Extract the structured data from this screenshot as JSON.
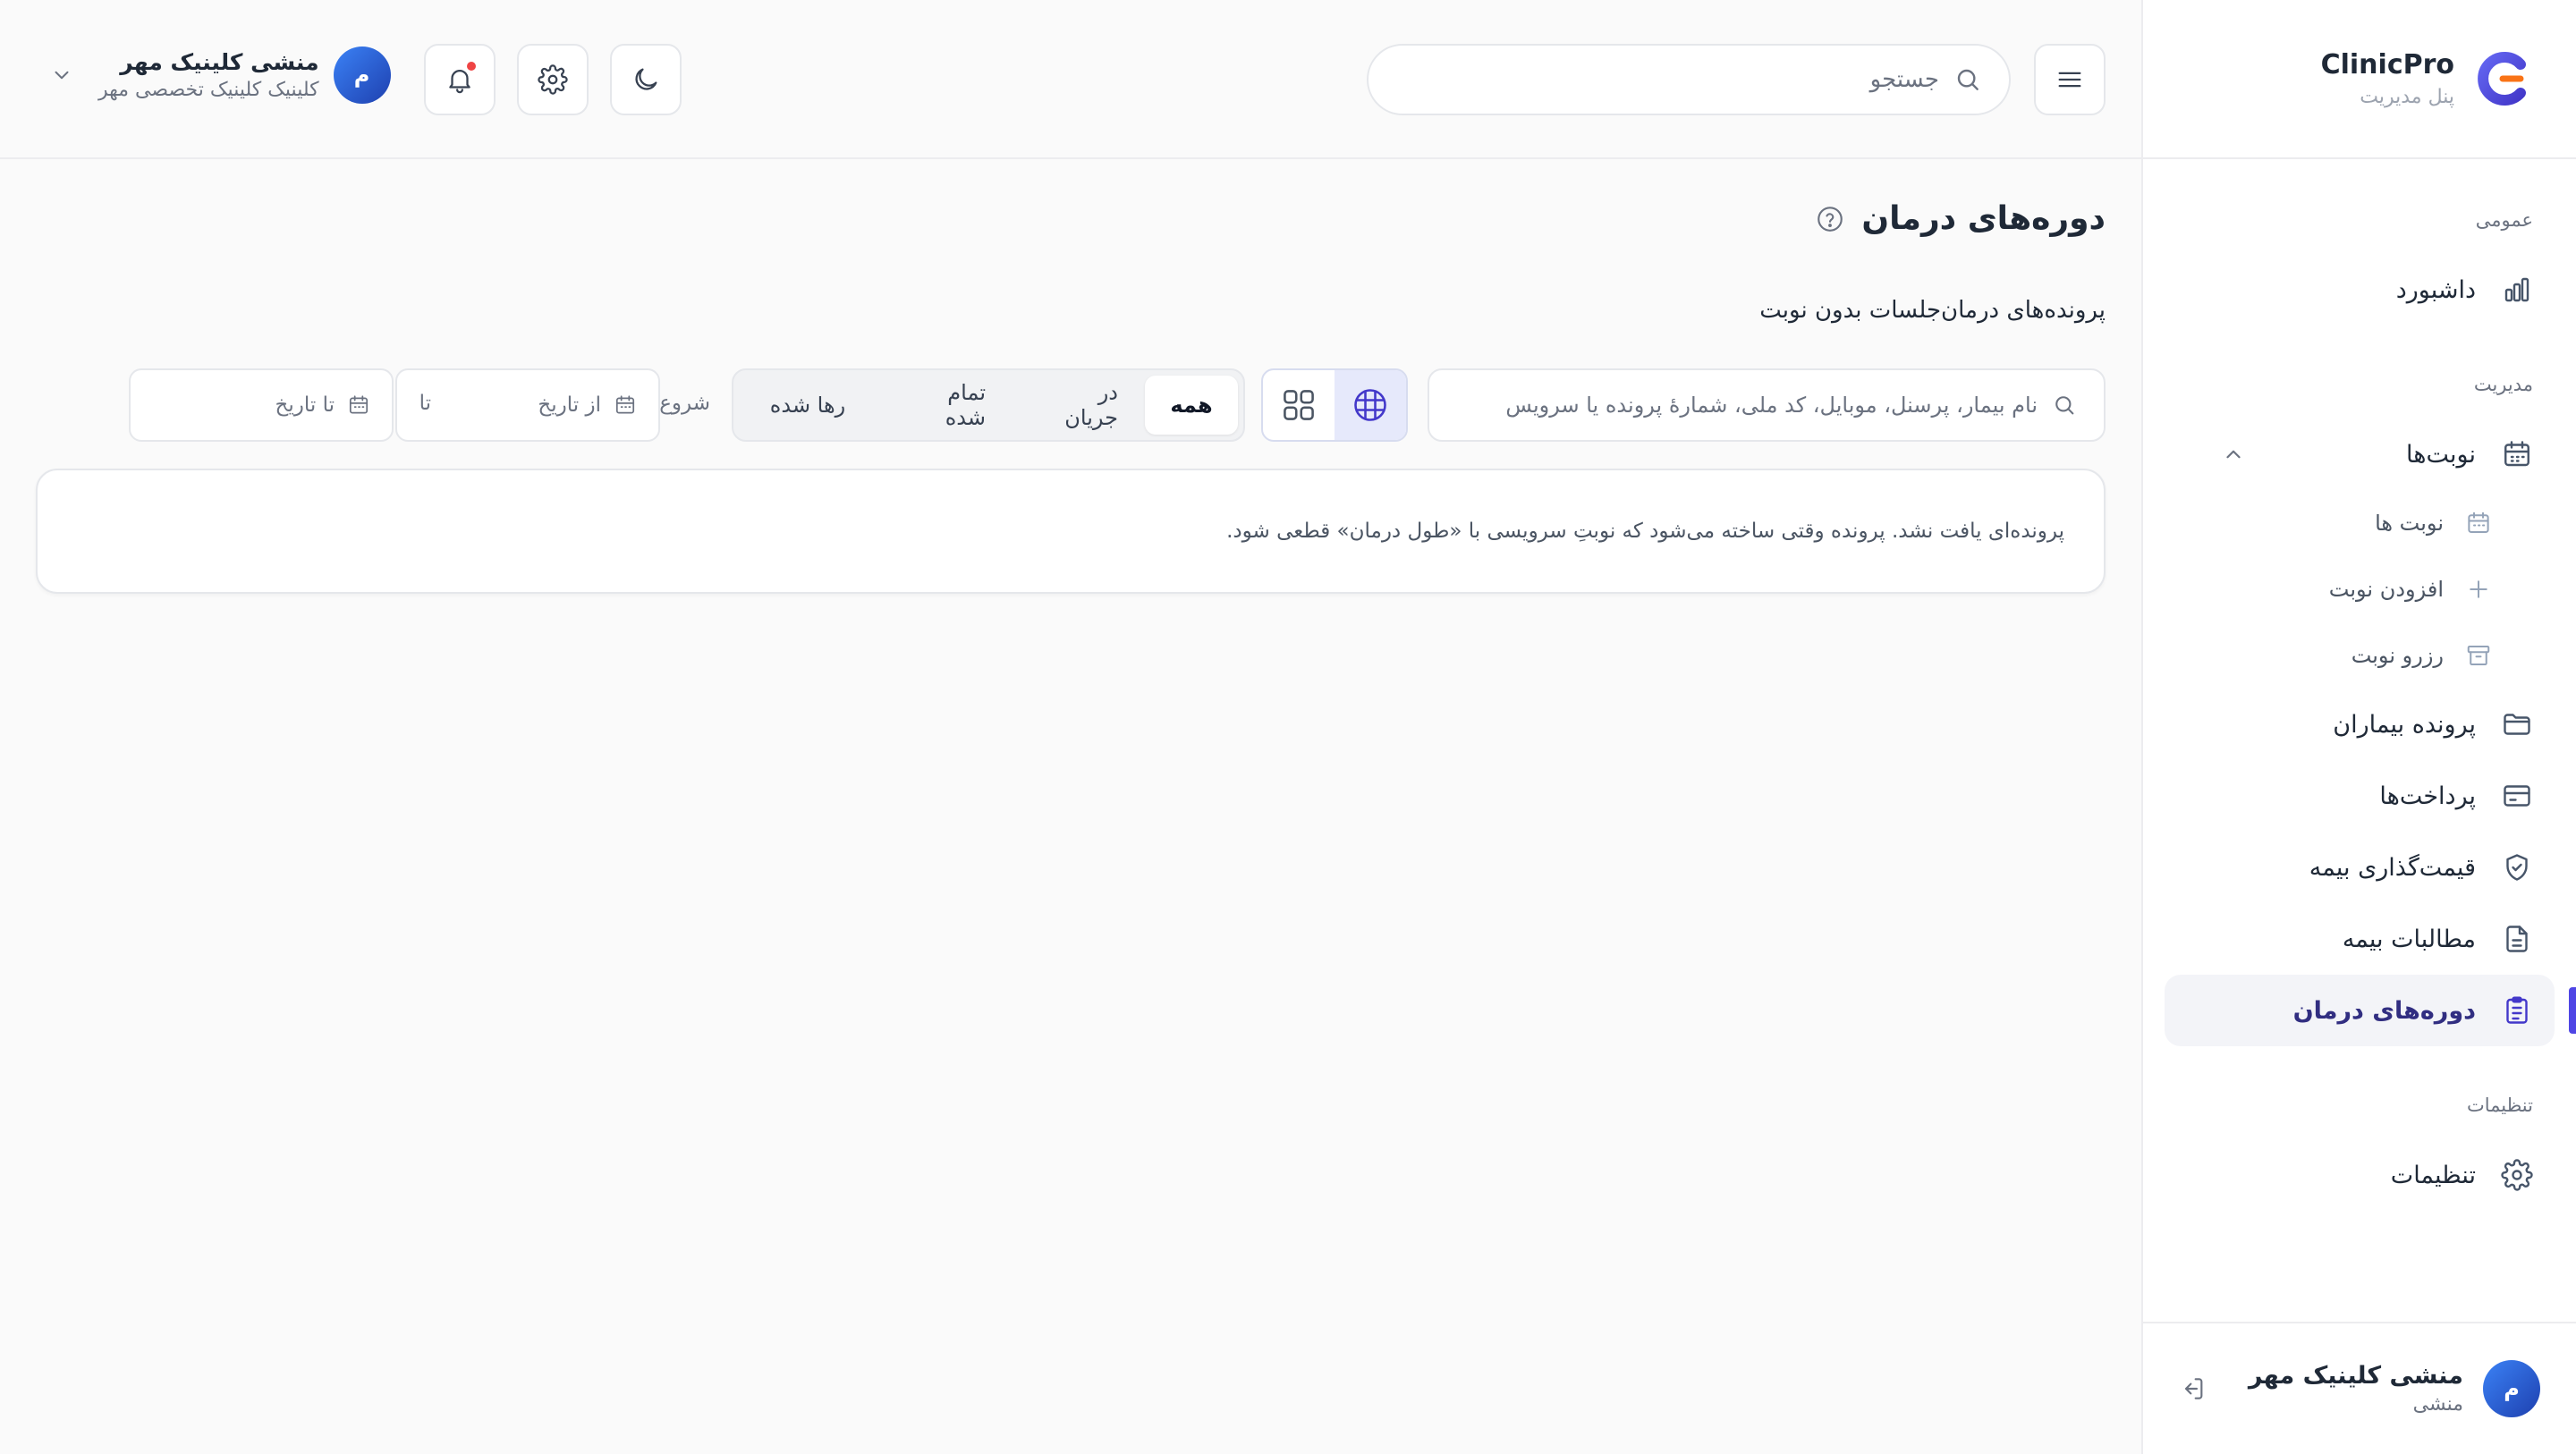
{
  "brand": {
    "name": "ClinicPro",
    "subtitle": "پنل مدیریت"
  },
  "sidebar": {
    "sections": {
      "general": "عمومی",
      "management": "مدیریت",
      "settings": "تنظیمات"
    },
    "items": {
      "dashboard": "داشبورد",
      "appointments": "نوبت‌ها",
      "appointments_list": "نوبت ها",
      "add_appointment": "افزودن نوبت",
      "reserve_appointment": "رزرو نوبت",
      "patient_records": "پرونده بیماران",
      "payments": "پرداخت‌ها",
      "insurance_pricing": "قیمت‌گذاری بیمه",
      "insurance_claims": "مطالبات بیمه",
      "treatment_courses": "دوره‌های درمان",
      "settings": "تنظیمات"
    },
    "footer": {
      "avatar_initial": "م",
      "name": "منشی کلینیک مهر",
      "role": "منشی"
    }
  },
  "header": {
    "search_placeholder": "جستجو",
    "user": {
      "avatar_initial": "م",
      "name": "منشی کلینیک مهر",
      "clinic": "کلینیک کلینیک تخصصی مهر"
    }
  },
  "main": {
    "title": "دوره‌های درمان",
    "subtitle": "پرونده‌های درمان‌جلسات بدون نوبت",
    "search_placeholder": "نام بیمار، پرسنل، موبایل، کد ملی، شمارهٔ پرونده یا سرویس",
    "tabs": [
      "همه",
      "در جریان",
      "تمام شده",
      "رها شده"
    ],
    "active_tab": "همه",
    "start_label": "شروع",
    "from_placeholder": "از تاریخ",
    "to_label": "تا",
    "to_placeholder": "تا تاریخ",
    "empty_message": "پرونده‌ای یافت نشد. پرونده وقتی ساخته می‌شود که نوبتِ سرویسی با «طول درمان» قطعی شود."
  },
  "colors": {
    "accent": "#4f46e5",
    "avatar": "#2563eb",
    "notification": "#ef4444"
  }
}
